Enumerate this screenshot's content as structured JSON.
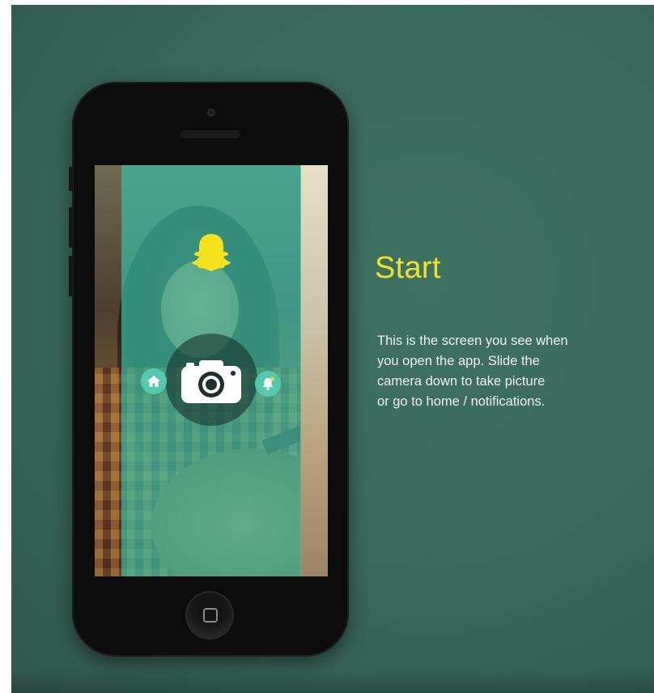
{
  "title": "Start",
  "description_lines": [
    "This is the screen you see when",
    "you open the app. Slide the",
    "camera down to take picture",
    "or go to home / notifications."
  ],
  "icons": {
    "logo": "ghost-logo-icon",
    "camera": "camera-icon",
    "home": "home-icon",
    "notifications": "bell-icon",
    "home_button": "home-button-icon"
  },
  "colors": {
    "background": "#3a6a5c",
    "title": "#f2e12a",
    "overlay": "#3abea5",
    "logo": "#f6e21c",
    "text": "#eef3f0"
  }
}
